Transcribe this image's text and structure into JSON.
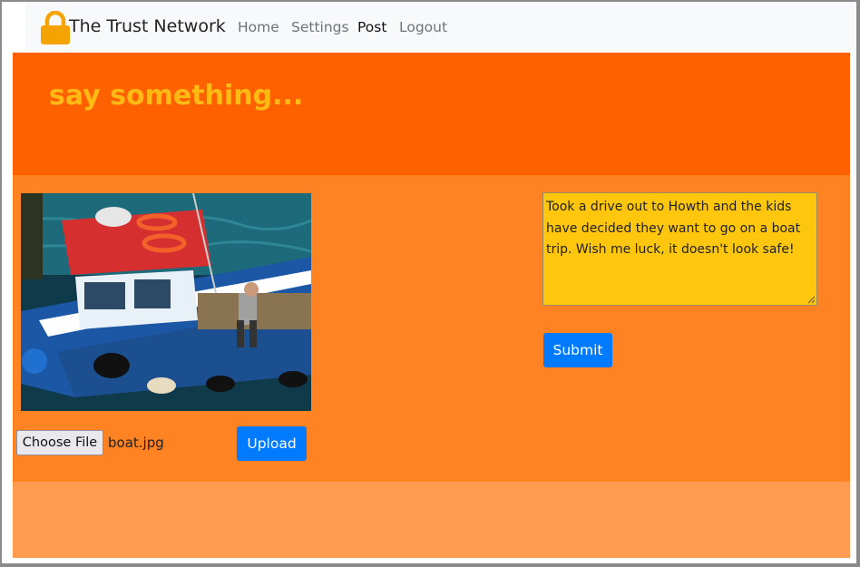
{
  "navbar": {
    "brand_icon": "padlock-icon",
    "brand": "The Trust Network",
    "links": [
      {
        "label": "Home",
        "active": false
      },
      {
        "label": "Settings",
        "active": false
      },
      {
        "label": "Post",
        "active": true
      },
      {
        "label": "Logout",
        "active": false
      }
    ]
  },
  "header": {
    "title": "say something..."
  },
  "upload": {
    "choose_label": "Choose File",
    "file_name": "boat.jpg",
    "upload_label": "Upload"
  },
  "post": {
    "text": "Took a drive out to Howth and the kids have decided they want to go on a boat trip. Wish me luck, it doesn't look safe!",
    "submit_label": "Submit"
  },
  "colors": {
    "header_bg": "#ff6000",
    "title": "#ffbb14",
    "main_bg": "#ff8223",
    "footer_bg": "#ff9c52",
    "textarea_bg": "#ffc60e",
    "button": "#007bff",
    "brand_icon": "#f5a300"
  }
}
